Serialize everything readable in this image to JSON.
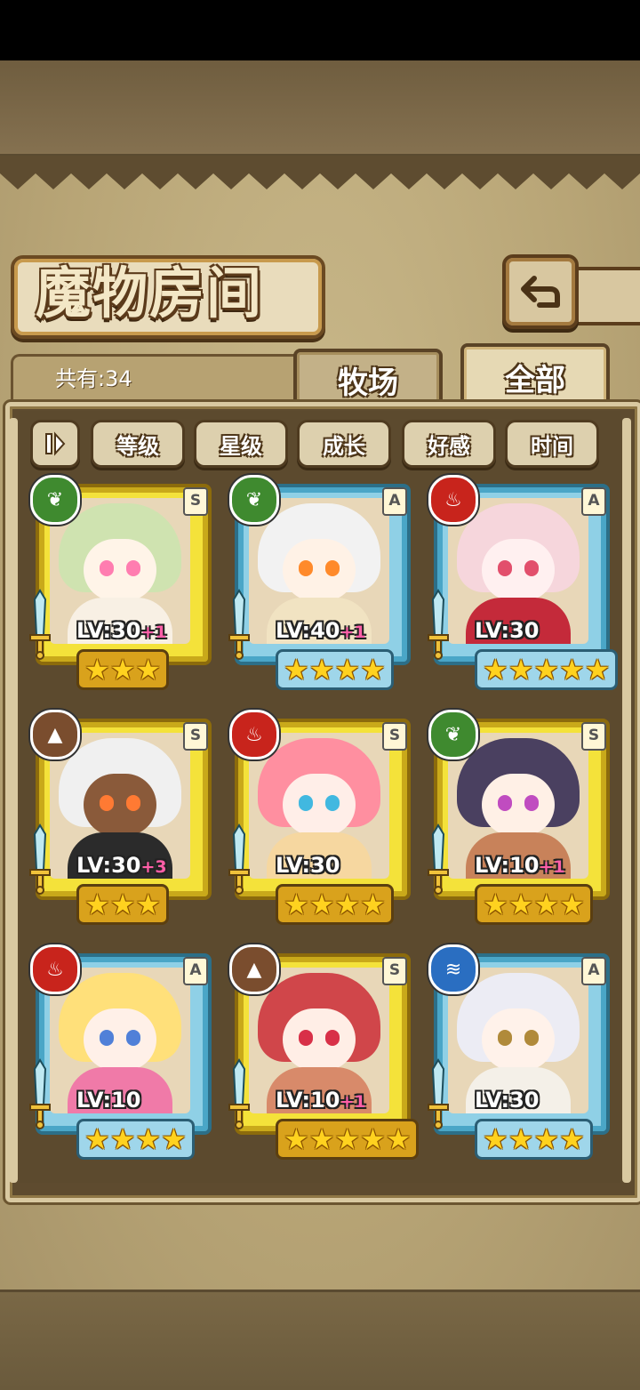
{
  "header": {
    "title": "魔物房间"
  },
  "summary": {
    "count_label": "共有:34"
  },
  "tabs": [
    {
      "label": "牧场",
      "active": false
    },
    {
      "label": "全部",
      "active": true
    }
  ],
  "filters": [
    "等级",
    "星级",
    "成长",
    "好感",
    "时间"
  ],
  "monsters": [
    {
      "element": "nature",
      "rank": "S",
      "frame": "gold",
      "level": "LV:30",
      "bonus": "+1",
      "stars": 3
    },
    {
      "element": "nature",
      "rank": "A",
      "frame": "blue",
      "level": "LV:40",
      "bonus": "+1",
      "stars": 4
    },
    {
      "element": "fire",
      "rank": "A",
      "frame": "blue",
      "level": "LV:30",
      "bonus": "",
      "stars": 5
    },
    {
      "element": "earth",
      "rank": "S",
      "frame": "gold",
      "level": "LV:30",
      "bonus": "+3",
      "stars": 3
    },
    {
      "element": "fire",
      "rank": "S",
      "frame": "gold",
      "level": "LV:30",
      "bonus": "",
      "stars": 4
    },
    {
      "element": "nature",
      "rank": "S",
      "frame": "gold",
      "level": "LV:10",
      "bonus": "+1",
      "stars": 4
    },
    {
      "element": "fire",
      "rank": "A",
      "frame": "blue",
      "level": "LV:10",
      "bonus": "",
      "stars": 4
    },
    {
      "element": "earth",
      "rank": "S",
      "frame": "gold",
      "level": "LV:10",
      "bonus": "+1",
      "stars": 5
    },
    {
      "element": "water",
      "rank": "A",
      "frame": "blue",
      "level": "LV:30",
      "bonus": "",
      "stars": 4
    }
  ],
  "colors": {
    "parchment": "#b8a576",
    "gold_frame": "#f4e23a",
    "blue_frame": "#8fd0e6",
    "bonus_pink": "#ff5fa8",
    "star_yellow": "#ffd21f"
  }
}
